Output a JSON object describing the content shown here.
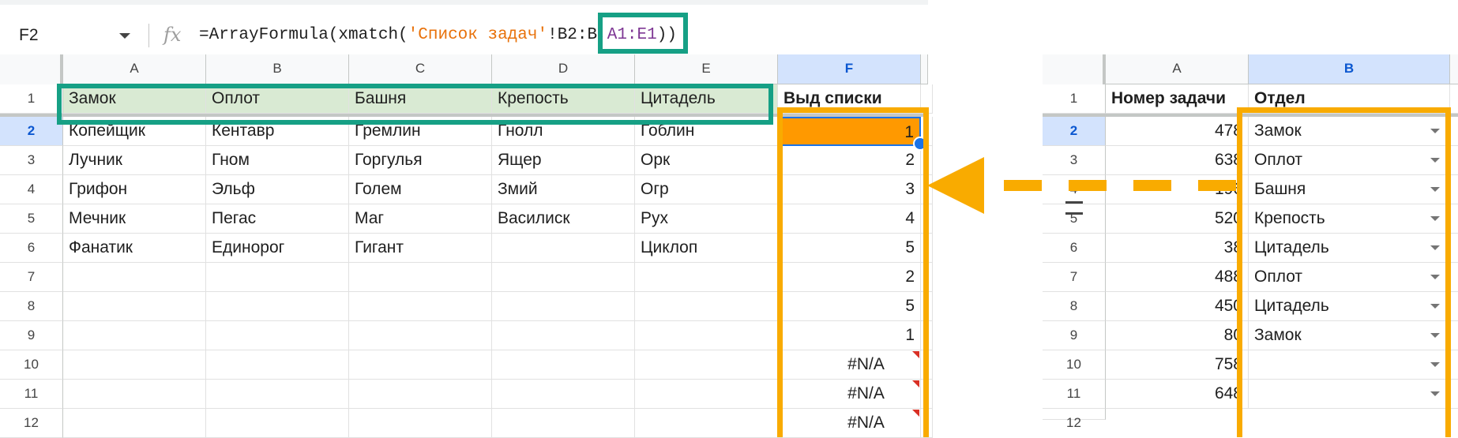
{
  "formula_bar": {
    "name_box": "F2",
    "fx_icon": "fx-icon",
    "formula_prefix": "=ArrayFormula(xmatch(",
    "formula_sheet": "'Список задач'",
    "formula_mid": "!B2:B,",
    "formula_range": "A1:E1",
    "formula_suffix": "))"
  },
  "left_sheet": {
    "columns": [
      "A",
      "B",
      "C",
      "D",
      "E",
      "F"
    ],
    "row_numbers": [
      "1",
      "2",
      "3",
      "4",
      "5",
      "6",
      "7",
      "8",
      "9",
      "10",
      "11",
      "12"
    ],
    "header_row": [
      "Замок",
      "Оплот",
      "Башня",
      "Крепость",
      "Цитадель",
      "Выд списки"
    ],
    "rows": [
      [
        "Копейщик",
        "Кентавр",
        "Гремлин",
        "Гнолл",
        "Гоблин",
        "1"
      ],
      [
        "Лучник",
        "Гном",
        "Горгулья",
        "Ящер",
        "Орк",
        "2"
      ],
      [
        "Грифон",
        "Эльф",
        "Голем",
        "Змий",
        "Огр",
        "3"
      ],
      [
        "Мечник",
        "Пегас",
        "Маг",
        "Василиск",
        "Рух",
        "4"
      ],
      [
        "Фанатик",
        "Единорог",
        "Гигант",
        "",
        "Циклоп",
        "5"
      ],
      [
        "",
        "",
        "",
        "",
        "",
        "2"
      ],
      [
        "",
        "",
        "",
        "",
        "",
        "5"
      ],
      [
        "",
        "",
        "",
        "",
        "",
        "1"
      ],
      [
        "",
        "",
        "",
        "",
        "",
        "#N/A"
      ],
      [
        "",
        "",
        "",
        "",
        "",
        "#N/A"
      ],
      [
        "",
        "",
        "",
        "",
        "",
        "#N/A"
      ]
    ],
    "selected_cell": "F2",
    "colors": {
      "header_fill": "#d9ead3",
      "active_fill": "#ff9900",
      "selection": "#1a73e8",
      "green_box": "#16a085",
      "orange_box": "#f9ab00"
    }
  },
  "right_sheet": {
    "columns": [
      "A",
      "B"
    ],
    "row_numbers": [
      "1",
      "2",
      "3",
      "4",
      "5",
      "6",
      "7",
      "8",
      "9",
      "10",
      "11",
      "12"
    ],
    "header": [
      "Номер задачи",
      "Отдел"
    ],
    "col_a": [
      "478",
      "638",
      "196",
      "520",
      "38",
      "488",
      "450",
      "80",
      "758",
      "648"
    ],
    "col_b": [
      "Замок",
      "Оплот",
      "Башня",
      "Крепость",
      "Цитадель",
      "Оплот",
      "Цитадель",
      "Замок",
      "",
      ""
    ],
    "dropdown_icon": "chevron-down-icon"
  }
}
